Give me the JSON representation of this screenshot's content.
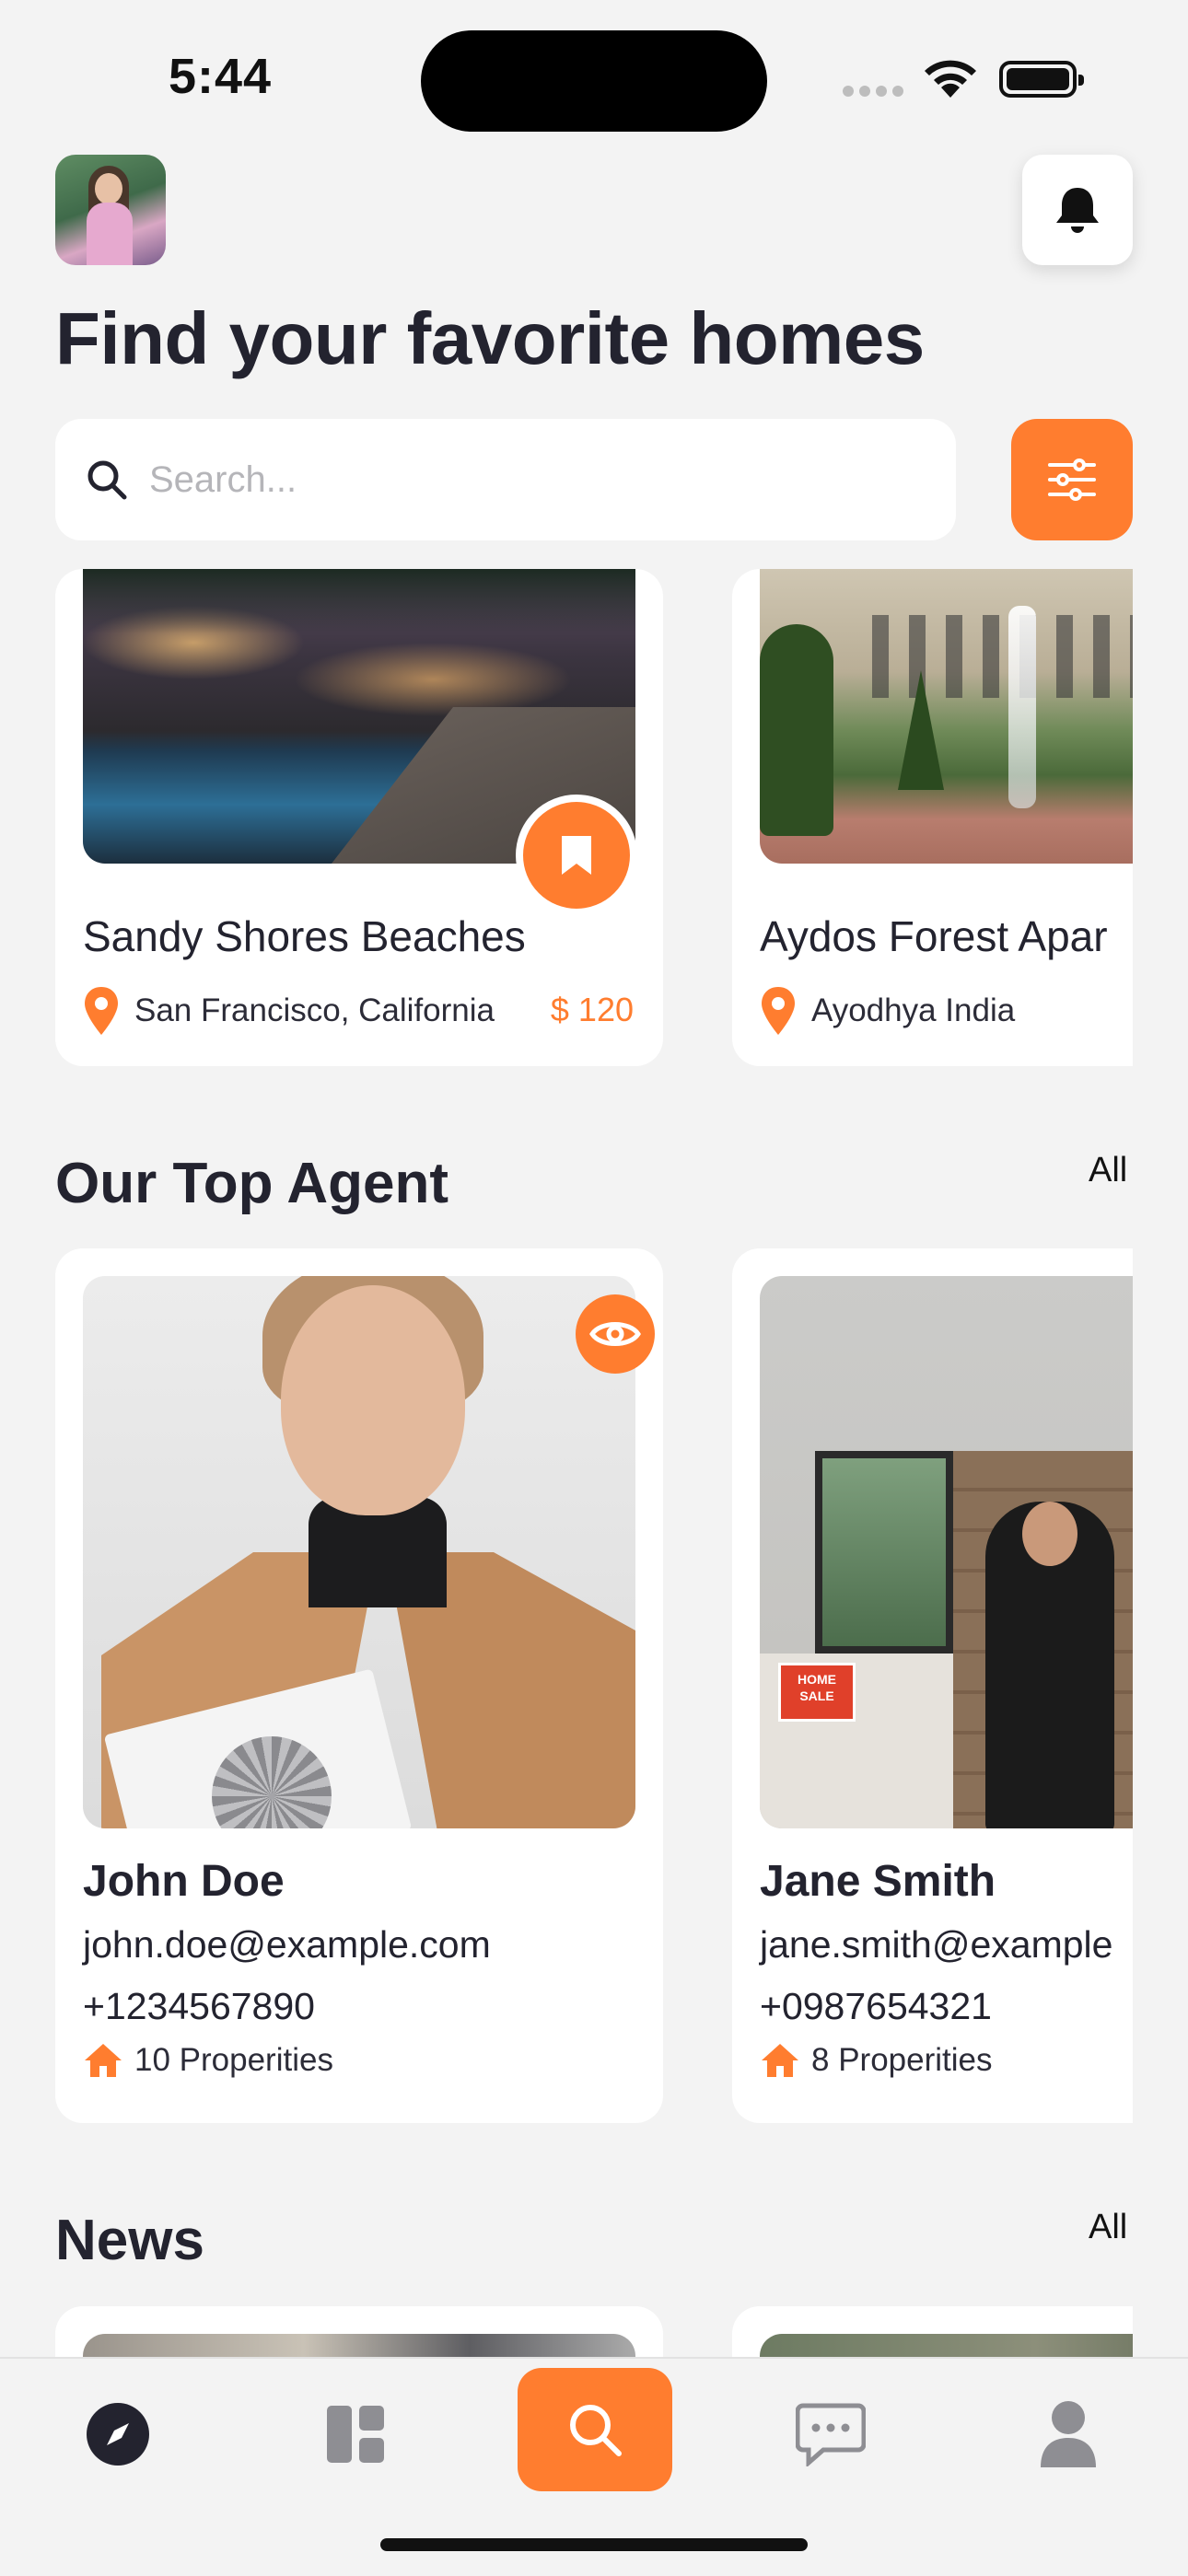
{
  "status_bar": {
    "time": "5:44"
  },
  "header": {
    "title": "Find your favorite homes",
    "avatar_icon": "user-avatar",
    "notification_icon": "bell-icon"
  },
  "search": {
    "placeholder": "Search...",
    "value": "",
    "filter_icon": "sliders-icon"
  },
  "properties": [
    {
      "name": "Sandy Shores Beaches",
      "location": "San Francisco, California",
      "price": "$ 120",
      "bookmarked": true
    },
    {
      "name": "Aydos Forest Apar",
      "location": "Ayodhya India",
      "price": ""
    }
  ],
  "agents_section": {
    "title": "Our Top Agent",
    "see_all": "All"
  },
  "agents": [
    {
      "name": "John Doe",
      "email": "john.doe@example.com",
      "phone": "+1234567890",
      "properties": "10 Properities"
    },
    {
      "name": "Jane Smith",
      "email": "jane.smith@example",
      "phone": "+0987654321",
      "properties": "8 Properities"
    }
  ],
  "news_section": {
    "title": "News",
    "see_all": "All"
  },
  "bottom_nav": {
    "items": [
      "compass-icon",
      "dashboard-icon",
      "search-icon",
      "chat-icon",
      "profile-icon"
    ],
    "active": "search-icon"
  },
  "colors": {
    "accent": "#ff7d2f",
    "text": "#23232f",
    "background": "#f3f3f3",
    "card": "#ffffff"
  }
}
